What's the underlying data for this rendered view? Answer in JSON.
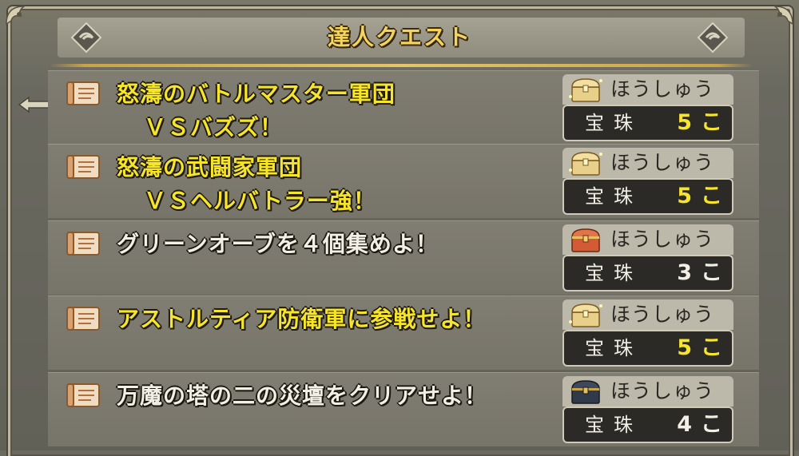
{
  "header": {
    "title": "達人クエスト"
  },
  "colors": {
    "yellow_text": "#f6e52a",
    "white_text": "#f2f0e6",
    "gold_accent": "#e6c46a"
  },
  "quests": [
    {
      "line1": "怒濤のバトルマスター軍団",
      "line2": "ＶＳバズズ！",
      "highlight": true,
      "chest_icon": "gold-chest-icon",
      "reward_label": "ほうしゅう",
      "reward_name": "宝珠",
      "count": "5",
      "unit": "こ"
    },
    {
      "line1": "怒濤の武闘家軍団",
      "line2": "ＶＳヘルバトラー強！",
      "highlight": true,
      "chest_icon": "gold-chest-icon",
      "reward_label": "ほうしゅう",
      "reward_name": "宝珠",
      "count": "5",
      "unit": "こ"
    },
    {
      "line1": "グリーンオーブを４個集めよ！",
      "line2": "",
      "highlight": false,
      "chest_icon": "red-chest-icon",
      "reward_label": "ほうしゅう",
      "reward_name": "宝珠",
      "count": "3",
      "unit": "こ"
    },
    {
      "line1": "アストルティア防衛軍に参戦せよ！",
      "line2": "",
      "highlight": true,
      "chest_icon": "gold-chest-icon",
      "reward_label": "ほうしゅう",
      "reward_name": "宝珠",
      "count": "5",
      "unit": "こ"
    },
    {
      "line1": "万魔の塔の二の災壇をクリアせよ！",
      "line2": "",
      "highlight": false,
      "chest_icon": "dark-chest-icon",
      "reward_label": "ほうしゅう",
      "reward_name": "宝珠",
      "count": "4",
      "unit": "こ"
    }
  ]
}
